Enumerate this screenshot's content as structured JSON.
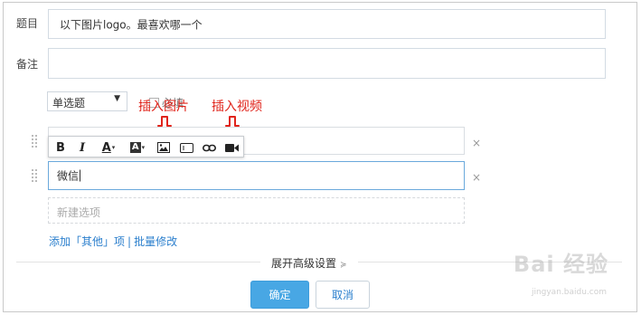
{
  "form": {
    "title_label": "题目",
    "title_value": "以下图片logo。最喜欢哪一个",
    "note_label": "备注",
    "note_value": "",
    "question_type": "单选题",
    "required_label": "必填"
  },
  "annotations": {
    "insert_image": "插入图片",
    "insert_video": "插入视频"
  },
  "toolbar": {
    "buttons": [
      "bold-icon",
      "italic-icon",
      "font-color-icon",
      "background-color-icon",
      "image-icon",
      "input-box-icon",
      "link-icon",
      "video-icon"
    ],
    "bold": "B",
    "italic": "I",
    "font_color": "A",
    "bg_color": "A"
  },
  "options": {
    "items": [
      "",
      "微信"
    ],
    "new_option_placeholder": "新建选项",
    "close_glyph": "×"
  },
  "links": {
    "add_other": "添加「其他」项",
    "separator": "|",
    "batch_edit": "批量修改"
  },
  "advanced_settings": "展开高级设置",
  "buttons": {
    "confirm": "确定",
    "cancel": "取消"
  },
  "watermark": {
    "main": "Bai 经验",
    "sub": "jingyan.baidu.com"
  },
  "colors": {
    "accent": "#48a7e4",
    "link": "#2b7fcd",
    "annotation": "#e0241b"
  }
}
